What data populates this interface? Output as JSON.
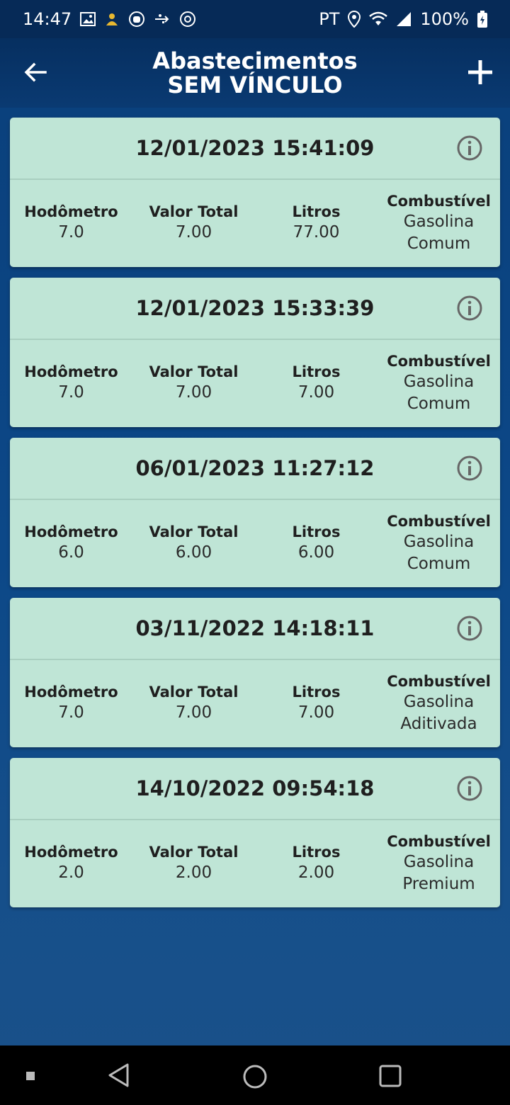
{
  "status_bar": {
    "time": "14:47",
    "carrier": "PT",
    "battery": "100%"
  },
  "header": {
    "title_line1": "Abastecimentos",
    "title_line2": "SEM VÍNCULO"
  },
  "labels": {
    "odometer": "Hodômetro",
    "total": "Valor Total",
    "liters": "Litros",
    "fuel": "Combustível"
  },
  "records": [
    {
      "date": "12/01/2023 15:41:09",
      "odometer": "7.0",
      "total": "7.00",
      "liters": "77.00",
      "fuel": "Gasolina Comum"
    },
    {
      "date": "12/01/2023 15:33:39",
      "odometer": "7.0",
      "total": "7.00",
      "liters": "7.00",
      "fuel": "Gasolina Comum"
    },
    {
      "date": "06/01/2023 11:27:12",
      "odometer": "6.0",
      "total": "6.00",
      "liters": "6.00",
      "fuel": "Gasolina Comum"
    },
    {
      "date": "03/11/2022 14:18:11",
      "odometer": "7.0",
      "total": "7.00",
      "liters": "7.00",
      "fuel": "Gasolina Aditivada"
    },
    {
      "date": "14/10/2022 09:54:18",
      "odometer": "2.0",
      "total": "2.00",
      "liters": "2.00",
      "fuel": "Gasolina Premium"
    }
  ]
}
